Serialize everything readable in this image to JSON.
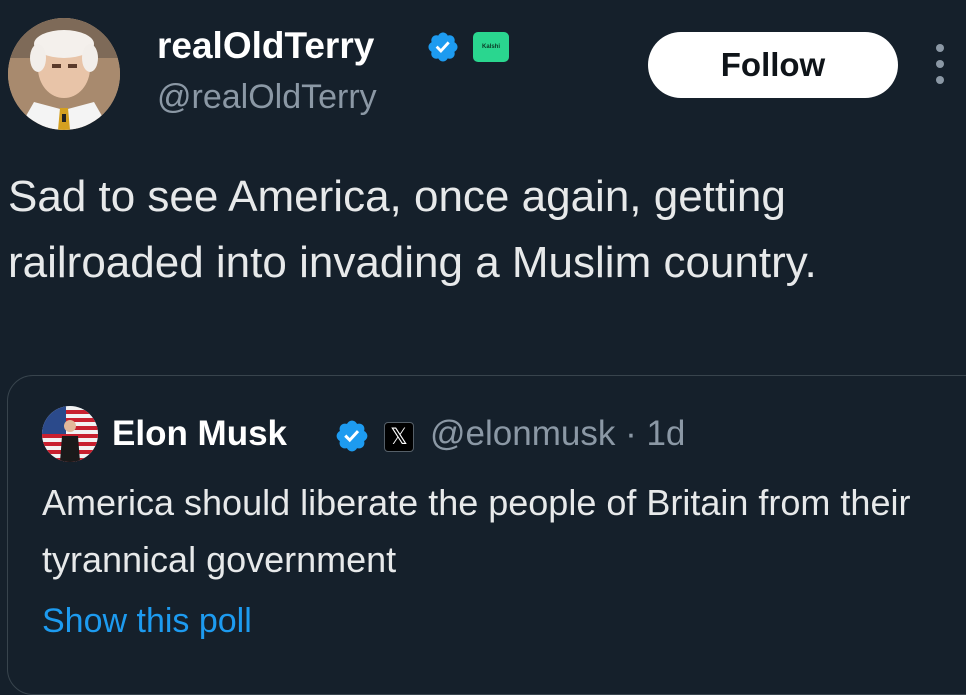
{
  "tweet": {
    "author": {
      "display_name": "realOldTerry",
      "handle": "@realOldTerry",
      "verified_icon": "verified-badge-icon",
      "affiliate_badge_text": "Kalshi",
      "affiliate_badge_color": "#2ad68f"
    },
    "follow_label": "Follow",
    "more_icon": "more-options-icon",
    "text": "Sad to see America, once again, getting railroaded into invading a Muslim country."
  },
  "quoted_tweet": {
    "author": {
      "display_name": "Elon Musk",
      "handle": "@elonmusk",
      "verified_icon": "verified-badge-icon",
      "affiliate_badge_text": "𝕏"
    },
    "timestamp": "· 1d",
    "text": "America should liberate the people of Britain from their tyrannical government",
    "show_poll_label": "Show this poll"
  },
  "colors": {
    "background": "#15202b",
    "primary_text": "#e7e9ea",
    "secondary_text": "#8b98a5",
    "accent": "#1d9bf0",
    "border": "#38444d"
  }
}
